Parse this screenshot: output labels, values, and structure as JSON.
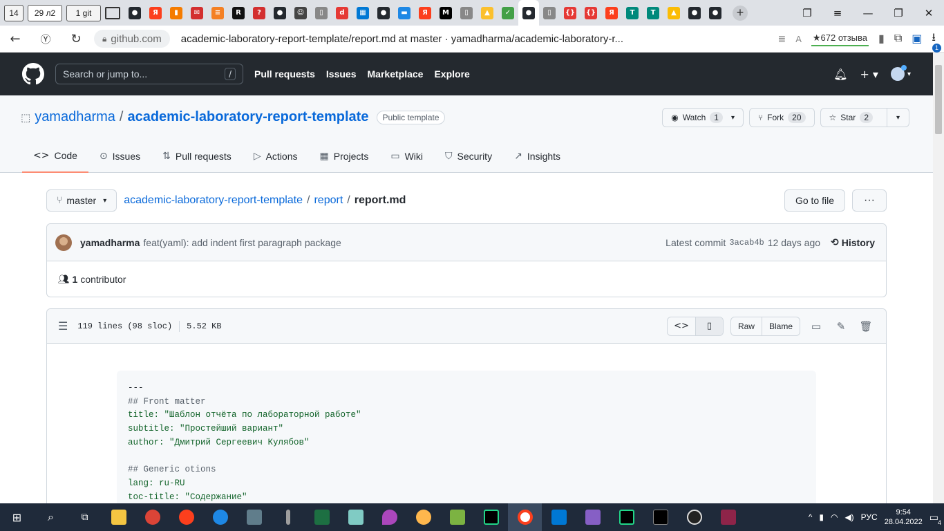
{
  "browser": {
    "tab_counter": "14",
    "active_tab_label": "29 л2",
    "git_tab_label": "1 git",
    "domain": "github.com",
    "url_title": "academic-laboratory-report-template/report.md at master · yamadharma/academic-laboratory-r...",
    "reviews": "★672 отзыва",
    "notif_count": "1"
  },
  "favicons": [
    {
      "name": "github-icon",
      "color": "#24292f",
      "glyph": "●"
    },
    {
      "name": "yandex-icon",
      "color": "#fc3f1d",
      "glyph": "Я"
    },
    {
      "name": "chart-icon",
      "color": "#f57c00",
      "glyph": "▮"
    },
    {
      "name": "mail-icon",
      "color": "#d32f2f",
      "glyph": "✉"
    },
    {
      "name": "stack-icon",
      "color": "#f48024",
      "glyph": "≡"
    },
    {
      "name": "re-icon",
      "color": "#111111",
      "glyph": "R"
    },
    {
      "name": "question-icon",
      "color": "#d32f2f",
      "glyph": "?"
    },
    {
      "name": "github-icon",
      "color": "#24292f",
      "glyph": "●"
    },
    {
      "name": "face-icon",
      "color": "#444444",
      "glyph": "☺"
    },
    {
      "name": "doc-icon",
      "color": "#888888",
      "glyph": "▯"
    },
    {
      "name": "diy-icon",
      "color": "#e53935",
      "glyph": "d"
    },
    {
      "name": "windows-icon",
      "color": "#0078d4",
      "glyph": "▦"
    },
    {
      "name": "github-icon",
      "color": "#24292f",
      "glyph": "●"
    },
    {
      "name": "chat-icon",
      "color": "#1e88e5",
      "glyph": "▬"
    },
    {
      "name": "yandex-icon",
      "color": "#fc3f1d",
      "glyph": "Я"
    },
    {
      "name": "medium-icon",
      "color": "#000000",
      "glyph": "M"
    },
    {
      "name": "doc-icon",
      "color": "#888888",
      "glyph": "▯"
    },
    {
      "name": "image-icon",
      "color": "#fbc02d",
      "glyph": "▲"
    },
    {
      "name": "check-icon",
      "color": "#43a047",
      "glyph": "✓"
    },
    {
      "name": "github-icon",
      "color": "#24292f",
      "glyph": "●"
    },
    {
      "name": "doc-icon",
      "color": "#888888",
      "glyph": "▯"
    },
    {
      "name": "braces-icon",
      "color": "#e53935",
      "glyph": "{}"
    },
    {
      "name": "braces-icon",
      "color": "#e53935",
      "glyph": "{}"
    },
    {
      "name": "yandex-icon",
      "color": "#fc3f1d",
      "glyph": "Я"
    },
    {
      "name": "tex-icon",
      "color": "#00897b",
      "glyph": "T"
    },
    {
      "name": "tex-icon",
      "color": "#00897b",
      "glyph": "T"
    },
    {
      "name": "drive-icon",
      "color": "#fbbc04",
      "glyph": "▲"
    },
    {
      "name": "github-icon",
      "color": "#24292f",
      "glyph": "●"
    },
    {
      "name": "github-icon",
      "color": "#24292f",
      "glyph": "●"
    }
  ],
  "header": {
    "search_placeholder": "Search or jump to...",
    "slash_key": "/",
    "nav": [
      "Pull requests",
      "Issues",
      "Marketplace",
      "Explore"
    ]
  },
  "repo": {
    "owner": "yamadharma",
    "separator": "/",
    "name": "academic-laboratory-report-template",
    "visibility": "Public template",
    "watch_label": "Watch",
    "watch_count": "1",
    "fork_label": "Fork",
    "fork_count": "20",
    "star_label": "Star",
    "star_count": "2",
    "tabs": [
      "Code",
      "Issues",
      "Pull requests",
      "Actions",
      "Projects",
      "Wiki",
      "Security",
      "Insights"
    ]
  },
  "file_nav": {
    "branch": "master",
    "crumb_repo": "academic-laboratory-report-template",
    "crumb_sep": "/",
    "crumb_dir": "report",
    "crumb_file": "report.md",
    "goto_file": "Go to file",
    "more": "···"
  },
  "commit": {
    "author": "yamadharma",
    "message": "feat(yaml): add indent first paragraph package",
    "latest_label": "Latest commit",
    "sha": "3acab4b",
    "ago": "12 days ago",
    "history": "History",
    "contributors_count": "1",
    "contributors_label": "contributor"
  },
  "file": {
    "lines": "119 lines (98 sloc)",
    "size": "5.52 KB",
    "raw": "Raw",
    "blame": "Blame"
  },
  "code_lines": [
    "---",
    "## Front matter",
    "title: \"Шаблон отчёта по лабораторной работе\"",
    "subtitle: \"Простейший вариант\"",
    "author: \"Дмитрий Сергеевич Кулябов\"",
    "",
    "## Generic otions",
    "lang: ru-RU",
    "toc-title: \"Содержание\""
  ],
  "taskbar": {
    "lang": "РУС",
    "time": "9:54",
    "date": "28.04.2022",
    "notifications": "4"
  }
}
